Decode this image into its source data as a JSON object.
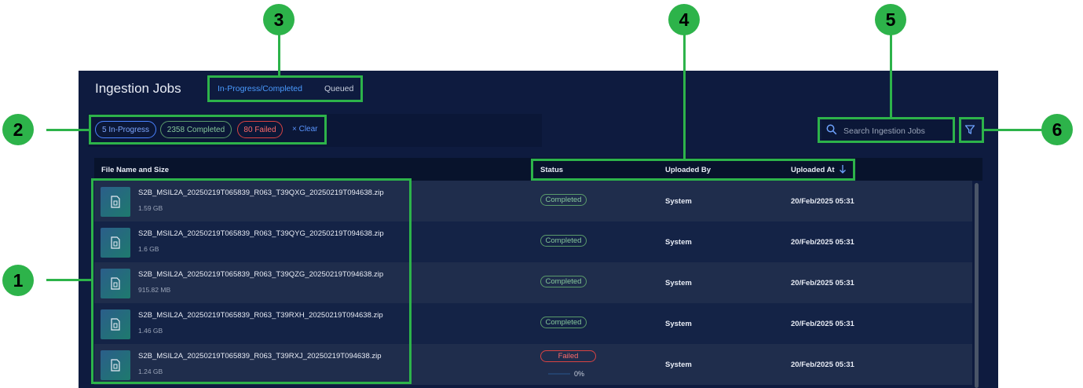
{
  "page": {
    "title": "Ingestion Jobs",
    "tabs": [
      {
        "label": "In-Progress/Completed",
        "active": true
      },
      {
        "label": "Queued",
        "active": false
      }
    ],
    "chips": [
      {
        "label": "5 In-Progress",
        "color": "#4a82ff"
      },
      {
        "label": "2358 Completed",
        "color": "#5a9a6a"
      },
      {
        "label": "80 Failed",
        "color": "#d84343"
      }
    ],
    "clear_label": "× Clear",
    "search": {
      "placeholder": "Search Ingestion Jobs",
      "value": ""
    },
    "icons": {
      "search": "search-icon",
      "filter": "filter-icon",
      "sort": "arrow-down-icon",
      "file": "file-icon"
    }
  },
  "table": {
    "columns": [
      "File Name and Size",
      "Status",
      "Uploaded By",
      "Uploaded At"
    ],
    "rows": [
      {
        "name": "S2B_MSIL2A_20250219T065839_R063_T39QXG_20250219T094638.zip",
        "size": "1.59 GB",
        "status": "Completed",
        "uploaded_by": "System",
        "uploaded_at": "20/Feb/2025 05:31"
      },
      {
        "name": "S2B_MSIL2A_20250219T065839_R063_T39QYG_20250219T094638.zip",
        "size": "1.6 GB",
        "status": "Completed",
        "uploaded_by": "System",
        "uploaded_at": "20/Feb/2025 05:31"
      },
      {
        "name": "S2B_MSIL2A_20250219T065839_R063_T39QZG_20250219T094638.zip",
        "size": "915.82 MB",
        "status": "Completed",
        "uploaded_by": "System",
        "uploaded_at": "20/Feb/2025 05:31"
      },
      {
        "name": "S2B_MSIL2A_20250219T065839_R063_T39RXH_20250219T094638.zip",
        "size": "1.46 GB",
        "status": "Completed",
        "uploaded_by": "System",
        "uploaded_at": "20/Feb/2025 05:31"
      },
      {
        "name": "S2B_MSIL2A_20250219T065839_R063_T39RXJ_20250219T094638.zip",
        "size": "1.24 GB",
        "status": "Failed",
        "uploaded_by": "System",
        "uploaded_at": "20/Feb/2025 05:31",
        "progress_label": "0%",
        "progress_fraction": 0.0
      }
    ]
  },
  "callouts": [
    "1",
    "2",
    "3",
    "4",
    "5",
    "6"
  ],
  "colors": {
    "accent": "#2db34a",
    "panel": "#0e1b3f",
    "link": "#4a9bff"
  }
}
